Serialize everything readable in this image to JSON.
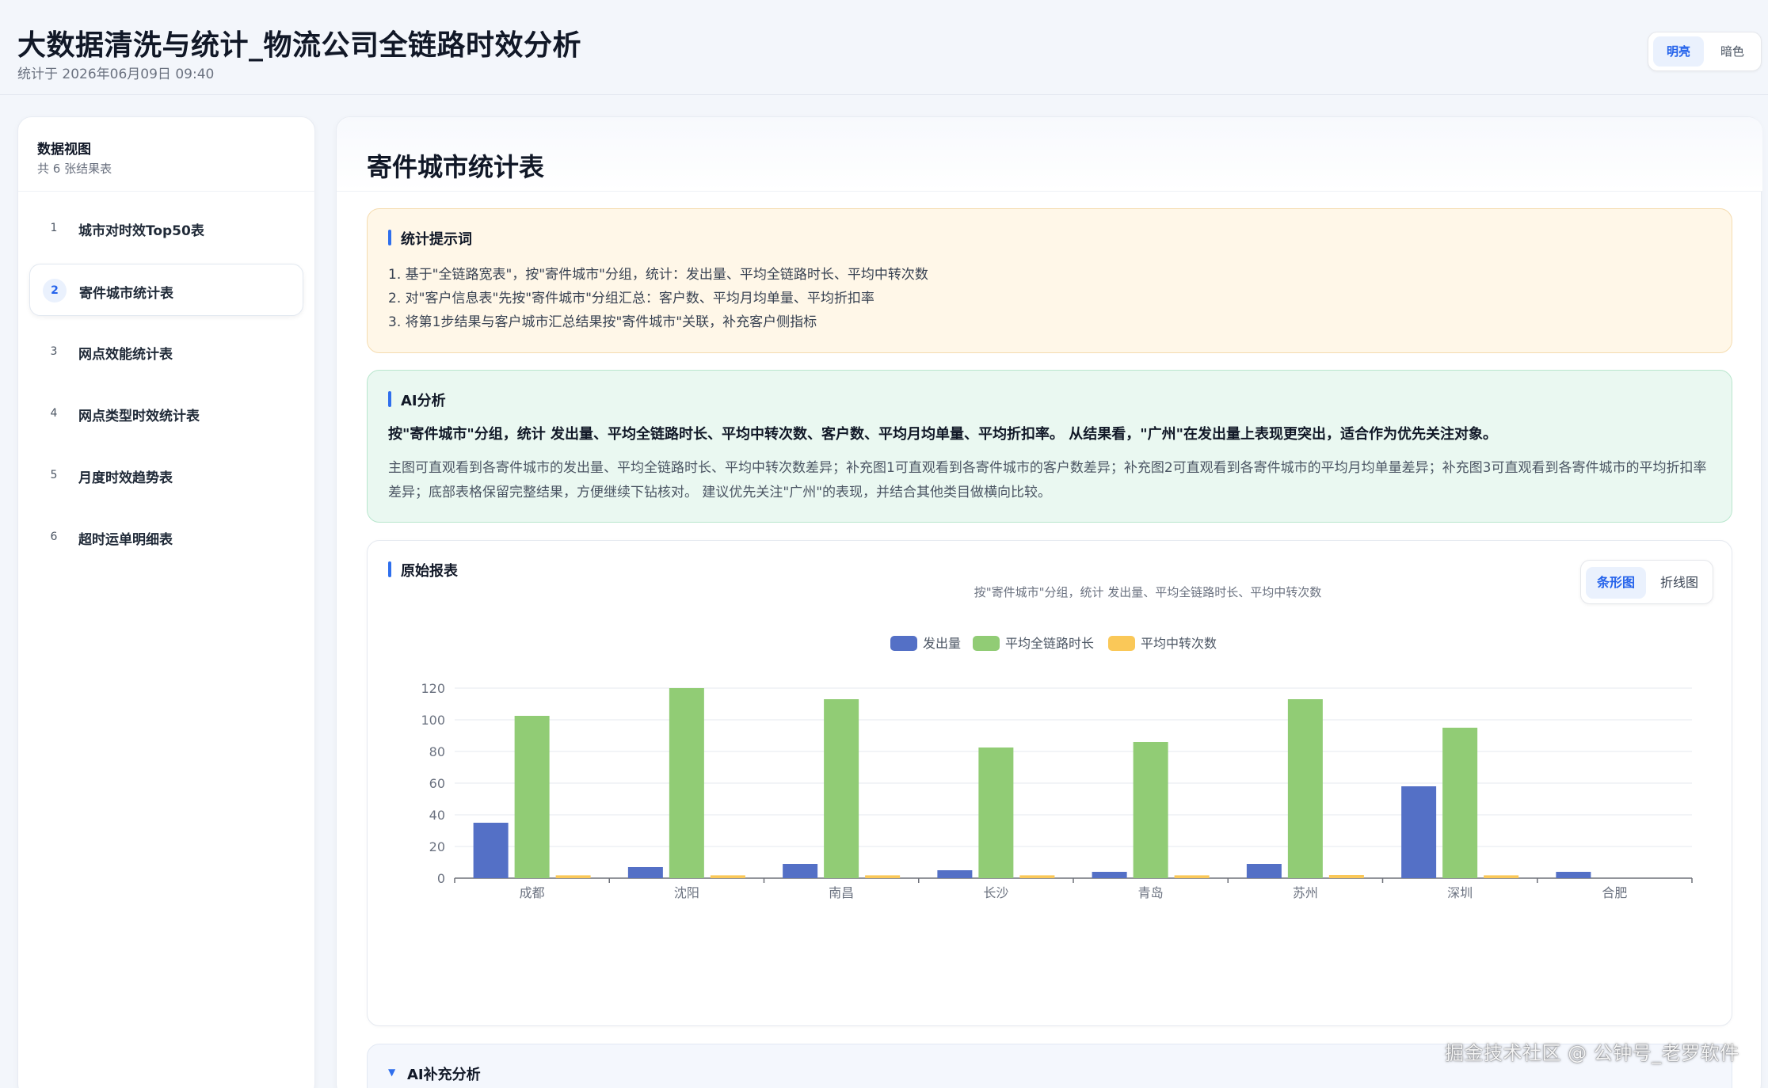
{
  "app": {
    "title": "大数据清洗与统计_物流公司全链路时效分析",
    "subtitle": "统计于 2026年06月09日 09:40"
  },
  "theme": {
    "light": "明亮",
    "dark": "暗色"
  },
  "sidebar": {
    "title": "数据视图",
    "count": "共 6 张结果表",
    "items": [
      {
        "num": "1",
        "label": "城市对时效Top50表"
      },
      {
        "num": "2",
        "label": "寄件城市统计表"
      },
      {
        "num": "3",
        "label": "网点效能统计表"
      },
      {
        "num": "4",
        "label": "网点类型时效统计表"
      },
      {
        "num": "5",
        "label": "月度时效趋势表"
      },
      {
        "num": "6",
        "label": "超时运单明细表"
      }
    ]
  },
  "main": {
    "title": "寄件城市统计表",
    "prompt": {
      "title": "统计提示词",
      "lines": [
        "1. 基于\"全链路宽表\"，按\"寄件城市\"分组，统计：发出量、平均全链路时长、平均中转次数",
        "2. 对\"客户信息表\"先按\"寄件城市\"分组汇总：客户数、平均月均单量、平均折扣率",
        "3. 将第1步结果与客户城市汇总结果按\"寄件城市\"关联，补充客户侧指标"
      ]
    },
    "ai": {
      "title": "AI分析",
      "headline": "按\"寄件城市\"分组，统计 发出量、平均全链路时长、平均中转次数、客户数、平均月均单量、平均折扣率。 从结果看，\"广州\"在发出量上表现更突出，适合作为优先关注对象。",
      "body": "主图可直观看到各寄件城市的发出量、平均全链路时长、平均中转次数差异；补充图1可直观看到各寄件城市的客户数差异；补充图2可直观看到各寄件城市的平均月均单量差异；补充图3可直观看到各寄件城市的平均折扣率差异；底部表格保留完整结果，方便继续下钻核对。 建议优先关注\"广州\"的表现，并结合其他类目做横向比较。"
    },
    "report": {
      "title": "原始报表",
      "toggle_bar": "条形图",
      "toggle_line": "折线图"
    },
    "supplement": {
      "title": "AI补充分析"
    }
  },
  "chart_data": {
    "type": "bar",
    "title": "按\"寄件城市\"分组，统计 发出量、平均全链路时长、平均中转次数",
    "categories": [
      "成都",
      "沈阳",
      "南昌",
      "长沙",
      "青岛",
      "苏州",
      "深圳",
      "合肥"
    ],
    "series": [
      {
        "name": "发出量",
        "color": "#5470c6",
        "values": [
          35,
          7,
          9,
          5,
          4,
          9,
          58,
          4
        ]
      },
      {
        "name": "平均全链路时长",
        "color": "#91cc75",
        "values": [
          102.5,
          120,
          113,
          82.5,
          86,
          113,
          95,
          0
        ]
      },
      {
        "name": "平均中转次数",
        "color": "#fac858",
        "values": [
          1.8,
          1.8,
          1.8,
          1.8,
          1.8,
          2,
          1.8,
          0
        ]
      }
    ],
    "ylim": [
      0,
      120
    ],
    "yticks": [
      0,
      20,
      40,
      60,
      80,
      100,
      120
    ],
    "legend_position": "top-center",
    "grid": true
  },
  "watermark": "掘金技术社区 @ 公钟号_老罗软件"
}
